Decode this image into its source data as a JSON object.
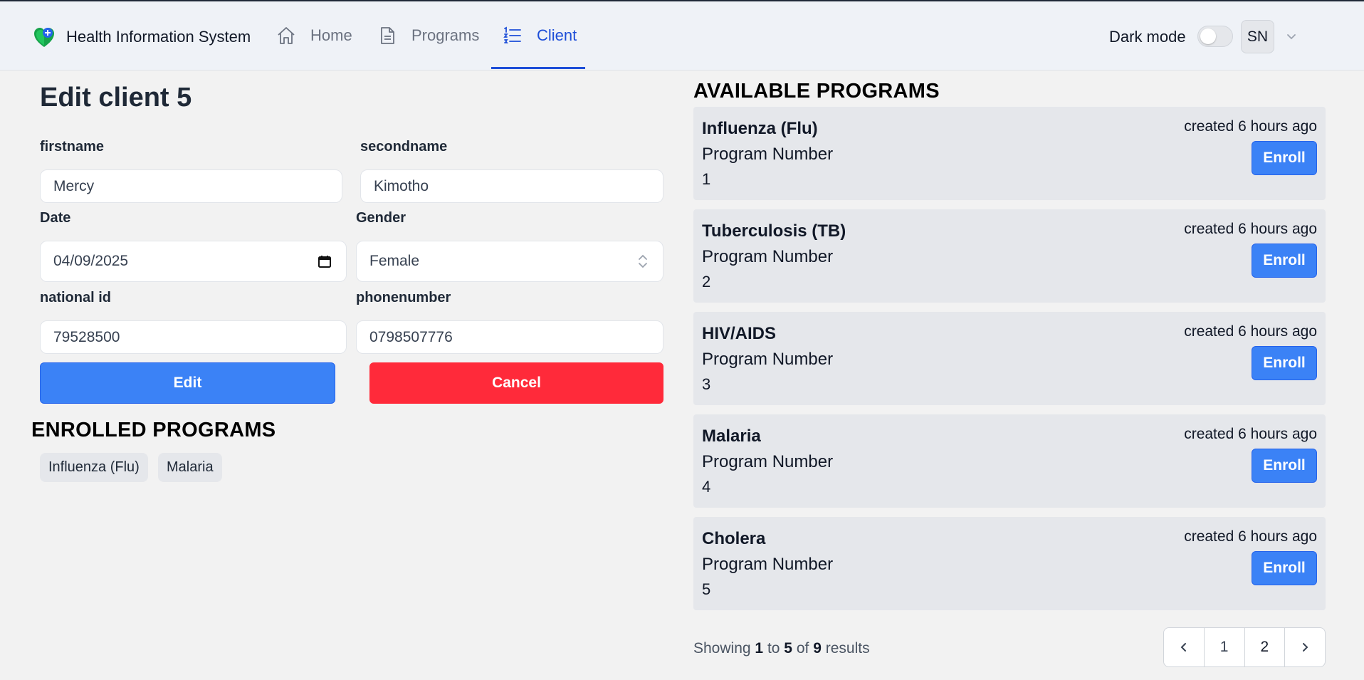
{
  "app": {
    "title": "Health Information System"
  },
  "nav": {
    "home": "Home",
    "programs": "Programs",
    "client": "Client",
    "dark_mode_label": "Dark mode",
    "avatar_initials": "SN"
  },
  "form": {
    "title": "Edit client 5",
    "firstname": {
      "label": "firstname",
      "value": "Mercy"
    },
    "secondname": {
      "label": "secondname",
      "value": "Kimotho"
    },
    "date": {
      "label": "Date",
      "value": "04/09/2025"
    },
    "gender": {
      "label": "Gender",
      "value": "Female"
    },
    "national_id": {
      "label": "national id",
      "value": "79528500"
    },
    "phonenumber": {
      "label": "phonenumber",
      "value": "0798507776"
    },
    "edit_label": "Edit",
    "cancel_label": "Cancel"
  },
  "enrolled": {
    "heading": "ENROLLED PROGRAMS",
    "items": [
      "Influenza (Flu)",
      "Malaria"
    ]
  },
  "available": {
    "heading": "AVAILABLE PROGRAMS",
    "number_label": "Program Number",
    "enroll_label": "Enroll",
    "programs": [
      {
        "name": "Influenza (Flu)",
        "number": "1",
        "created": "created 6 hours ago"
      },
      {
        "name": "Tuberculosis (TB)",
        "number": "2",
        "created": "created 6 hours ago"
      },
      {
        "name": "HIV/AIDS",
        "number": "3",
        "created": "created 6 hours ago"
      },
      {
        "name": "Malaria",
        "number": "4",
        "created": "created 6 hours ago"
      },
      {
        "name": "Cholera",
        "number": "5",
        "created": "created 6 hours ago"
      }
    ]
  },
  "pagination": {
    "showing_prefix": "Showing",
    "from": "1",
    "to_word": "to",
    "to": "5",
    "of_word": "of",
    "total": "9",
    "results_word": "results",
    "pages": [
      "1",
      "2"
    ],
    "current_page": "2"
  },
  "colors": {
    "primary": "#3b82f6",
    "danger": "#ff2a3a",
    "nav_active": "#1d4ed8"
  }
}
